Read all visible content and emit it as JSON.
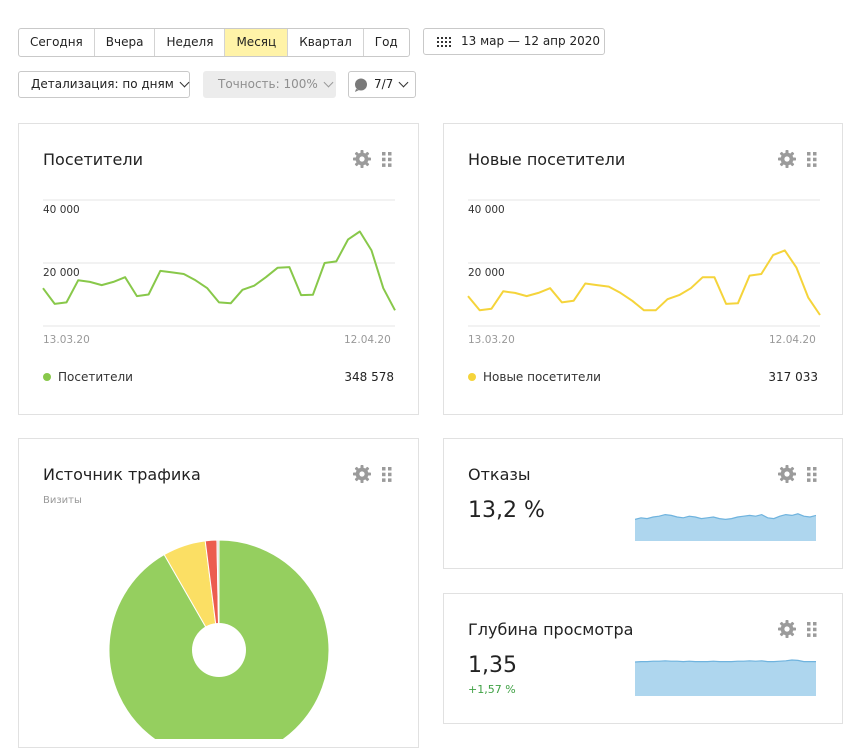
{
  "toolbar": {
    "periods": [
      {
        "label": "Сегодня",
        "active": false
      },
      {
        "label": "Вчера",
        "active": false
      },
      {
        "label": "Неделя",
        "active": false
      },
      {
        "label": "Месяц",
        "active": true
      },
      {
        "label": "Квартал",
        "active": false
      },
      {
        "label": "Год",
        "active": false
      }
    ],
    "date_range": "13 мар — 12 апр 2020",
    "detail_label": "Детализация: по дням",
    "accuracy_label": "Точность: 100%",
    "segments_label": "7/7"
  },
  "colors": {
    "visitors": "#88c84a",
    "new_visitors": "#f5d43b",
    "bounce_fill": "#aed6ee",
    "bounce_line": "#6fb3de",
    "pie_green": "#95cf5f",
    "pie_yellow": "#fbdf64",
    "pie_red": "#ec5c4f",
    "delta_positive": "#3fa144",
    "active_period": "#fff3a8"
  },
  "widgets": {
    "visitors": {
      "title": "Посетители",
      "legend": "Посетители",
      "total": "348 578",
      "x_start": "13.03.20",
      "x_end": "12.04.20",
      "y_ticks": [
        "20 000",
        "40 000"
      ]
    },
    "new_visitors": {
      "title": "Новые посетители",
      "legend": "Новые посетители",
      "total": "317 033",
      "x_start": "13.03.20",
      "x_end": "12.04.20",
      "y_ticks": [
        "20 000",
        "40 000"
      ]
    },
    "traffic": {
      "title": "Источник трафика",
      "subtitle": "Визиты"
    },
    "bounce": {
      "title": "Отказы",
      "value": "13,2 %"
    },
    "depth": {
      "title": "Глубина просмотра",
      "value": "1,35",
      "delta": "+1,57 %"
    }
  },
  "chart_data": [
    {
      "type": "line",
      "x": [
        "13.03.20",
        "14.03.20",
        "15.03.20",
        "16.03.20",
        "17.03.20",
        "18.03.20",
        "19.03.20",
        "20.03.20",
        "21.03.20",
        "22.03.20",
        "23.03.20",
        "24.03.20",
        "25.03.20",
        "26.03.20",
        "27.03.20",
        "28.03.20",
        "29.03.20",
        "30.03.20",
        "31.03.20",
        "01.04.20",
        "02.04.20",
        "03.04.20",
        "04.04.20",
        "05.04.20",
        "06.04.20",
        "07.04.20",
        "08.04.20",
        "09.04.20",
        "10.04.20",
        "11.04.20",
        "12.04.20"
      ],
      "series": [
        {
          "name": "Посетители",
          "values": [
            12000,
            7000,
            7500,
            14500,
            14000,
            13000,
            14000,
            15500,
            9500,
            10000,
            17500,
            17000,
            16500,
            14500,
            12000,
            7500,
            7200,
            11500,
            12800,
            15500,
            18500,
            18700,
            9800,
            9900,
            20000,
            20500,
            27500,
            30000,
            24000,
            12000,
            5000
          ]
        }
      ],
      "y_ticks": [
        20000,
        40000
      ],
      "ylim": [
        0,
        43000
      ]
    },
    {
      "type": "line",
      "x": [
        "13.03.20",
        "14.03.20",
        "15.03.20",
        "16.03.20",
        "17.03.20",
        "18.03.20",
        "19.03.20",
        "20.03.20",
        "21.03.20",
        "22.03.20",
        "23.03.20",
        "24.03.20",
        "25.03.20",
        "26.03.20",
        "27.03.20",
        "28.03.20",
        "29.03.20",
        "30.03.20",
        "31.03.20",
        "01.04.20",
        "02.04.20",
        "03.04.20",
        "04.04.20",
        "05.04.20",
        "06.04.20",
        "07.04.20",
        "08.04.20",
        "09.04.20",
        "10.04.20",
        "11.04.20",
        "12.04.20"
      ],
      "series": [
        {
          "name": "Новые посетители",
          "values": [
            9500,
            5000,
            5500,
            11000,
            10500,
            9500,
            10500,
            12000,
            7500,
            8000,
            13500,
            13000,
            12500,
            10500,
            8000,
            5000,
            5000,
            8500,
            9800,
            12000,
            15500,
            15500,
            7000,
            7200,
            16000,
            16500,
            22500,
            24000,
            18500,
            9000,
            3500
          ]
        }
      ],
      "y_ticks": [
        20000,
        40000
      ],
      "ylim": [
        0,
        43000
      ]
    },
    {
      "type": "pie",
      "slices": [
        {
          "value": 91.7
        },
        {
          "value": 6.3
        },
        {
          "value": 1.7
        },
        {
          "value": 0.3
        }
      ]
    },
    {
      "type": "area",
      "values": [
        0.54,
        0.58,
        0.56,
        0.6,
        0.62,
        0.66,
        0.64,
        0.6,
        0.58,
        0.62,
        0.6,
        0.56,
        0.58,
        0.6,
        0.56,
        0.54,
        0.56,
        0.6,
        0.62,
        0.64,
        0.62,
        0.66,
        0.58,
        0.56,
        0.62,
        0.66,
        0.64,
        0.68,
        0.62,
        0.6,
        0.64
      ]
    },
    {
      "type": "area",
      "values": [
        0.85,
        0.86,
        0.86,
        0.87,
        0.87,
        0.88,
        0.87,
        0.87,
        0.86,
        0.87,
        0.86,
        0.86,
        0.86,
        0.87,
        0.86,
        0.86,
        0.86,
        0.87,
        0.87,
        0.88,
        0.87,
        0.88,
        0.86,
        0.86,
        0.87,
        0.88,
        0.9,
        0.89,
        0.86,
        0.86,
        0.86
      ]
    }
  ]
}
